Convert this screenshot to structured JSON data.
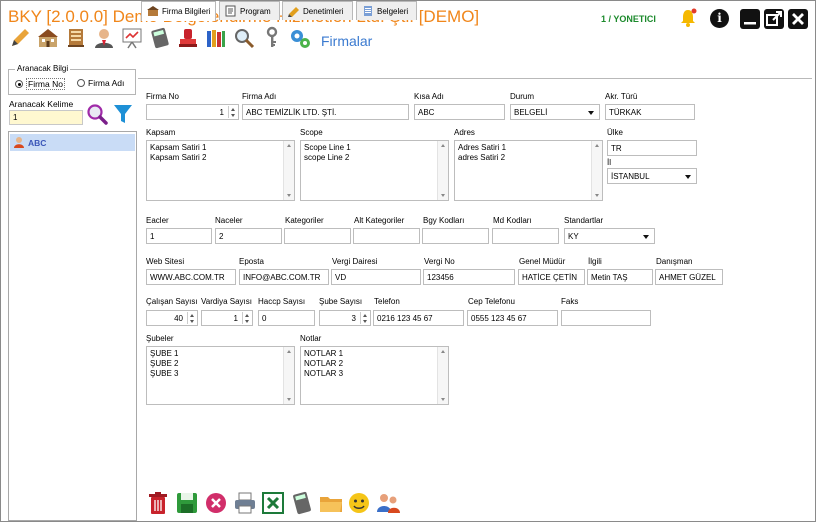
{
  "app": {
    "title": "BKY [2.0.0.0] Demo Belgelendirme Hizmetleri Ltd. Şti. [DEMO]",
    "user": "1 / YONETICI",
    "module_title": "Firmalar"
  },
  "toolbar_icons": [
    "pencil-icon",
    "house-icon",
    "building-icon",
    "user-icon",
    "presentation-icon",
    "calculator-icon",
    "stamp-icon",
    "books-icon",
    "magnifier-icon",
    "key-icon",
    "gears-icon"
  ],
  "colors": {
    "title": "#f0861a",
    "user": "#1c8a2c",
    "module": "#3a7ad0",
    "selection": "#c9dcf6"
  },
  "search": {
    "group_label": "Aranacak Bilgi",
    "option_firma_no": "Firma No",
    "option_firma_adi": "Firma Adı",
    "selected": "Firma No",
    "keyword_label": "Aranacak Kelime",
    "keyword_value": "1"
  },
  "list": {
    "items": [
      {
        "label": "ABC"
      }
    ]
  },
  "tabs": [
    "Firma Bilgileri",
    "Program",
    "Denetimleri",
    "Belgeleri"
  ],
  "form": {
    "firma_no_label": "Firma No",
    "firma_no": "1",
    "firma_adi_label": "Firma Adı",
    "firma_adi": "ABC TEMİZLİK LTD. ŞTİ.",
    "kisa_adi_label": "Kısa Adı",
    "kisa_adi": "ABC",
    "durum_label": "Durum",
    "durum": "BELGELİ",
    "akr_turu_label": "Akr. Türü",
    "akr_turu": "TÜRKAK",
    "kapsam_label": "Kapsam",
    "kapsam_1": "Kapsam Satiri 1",
    "kapsam_2": "Kapsam Satiri 2",
    "scope_label": "Scope",
    "scope_1": "Scope Line 1",
    "scope_2": "scope Line 2",
    "adres_label": "Adres",
    "adres_1": "Adres Satiri 1",
    "adres_2": "adres Satiri 2",
    "ulke_label": "Ülke",
    "ulke": "TR",
    "il_label": "İl",
    "il": "İSTANBUL",
    "eacler_label": "Eacler",
    "eacler": "1",
    "naceler_label": "Naceler",
    "naceler": "2",
    "kategoriler_label": "Kategoriler",
    "kategoriler": "",
    "alt_kategoriler_label": "Alt Kategoriler",
    "alt_kategoriler": "",
    "bgy_kodlari_label": "Bgy Kodları",
    "bgy_kodlari": "",
    "md_kodlari_label": "Md Kodları",
    "md_kodlari": "",
    "standartlar_label": "Standartlar",
    "standartlar": "KY",
    "web_label": "Web Sitesi",
    "web": "WWW.ABC.COM.TR",
    "eposta_label": "Eposta",
    "eposta": "INFO@ABC.COM.TR",
    "vergi_dairesi_label": "Vergi Dairesi",
    "vergi_dairesi": "VD",
    "vergi_no_label": "Vergi No",
    "vergi_no": "123456",
    "genel_mudur_label": "Genel Müdür",
    "genel_mudur": "HATİCE ÇETİN",
    "ilgili_label": "İlgili",
    "ilgili": "Metin TAŞ",
    "danisman_label": "Danışman",
    "danisman": "AHMET GÜZEL",
    "calisan_label": "Çalışan Sayısı",
    "calisan": "40",
    "vardiya_label": "Vardiya Sayısı",
    "vardiya": "1",
    "haccp_label": "Haccp Sayısı",
    "haccp": "0",
    "sube_sayisi_label": "Şube Sayısı",
    "sube_sayisi": "3",
    "telefon_label": "Telefon",
    "telefon": "0216 123 45 67",
    "cep_label": "Cep Telefonu",
    "cep": "0555 123 45 67",
    "faks_label": "Faks",
    "faks": "",
    "subeler_label": "Şubeler",
    "sube_1": "ŞUBE 1",
    "sube_2": "ŞUBE 2",
    "sube_3": "ŞUBE 3",
    "notlar_label": "Notlar",
    "not_1": "NOTLAR 1",
    "not_2": "NOTLAR 2",
    "not_3": "NOTLAR 3"
  },
  "bottom_icons": [
    "trash-icon",
    "save-icon",
    "cancel-icon",
    "print-icon",
    "excel-icon",
    "calculator-icon",
    "folder-icon",
    "smiley-icon",
    "users-icon"
  ]
}
